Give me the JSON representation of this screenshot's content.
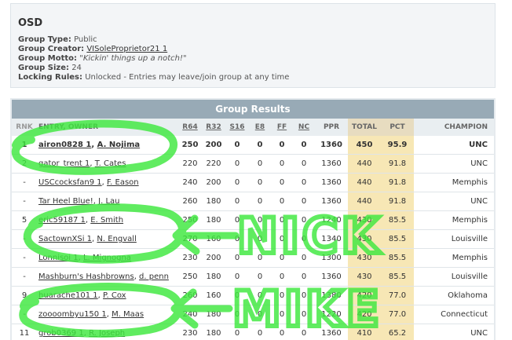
{
  "group": {
    "name": "OSD",
    "type_label": "Group Type:",
    "type_value": "Public",
    "creator_label": "Group Creator:",
    "creator_value": "VISoleProprietor21 1",
    "motto_label": "Group Motto:",
    "motto_value": "\"Kickin' things up a notch!\"",
    "size_label": "Group Size:",
    "size_value": "24",
    "locking_label": "Locking Rules:",
    "locking_value": "Unlocked - Entries may leave/join group at any time"
  },
  "results": {
    "title": "Group Results",
    "headers": {
      "rnk": "RNK",
      "entry": "ENTRY, OWNER",
      "r64": "R64",
      "r32": "R32",
      "s16": "S16",
      "e8": "E8",
      "ff": "FF",
      "nc": "NC",
      "ppr": "PPR",
      "total": "TOTAL",
      "pct": "PCT",
      "champion": "CHAMPION"
    },
    "rows": [
      {
        "rnk": "1",
        "entry": "airon0828 1",
        "owner": "A. Nojima",
        "r64": "250",
        "r32": "200",
        "s16": "0",
        "e8": "0",
        "ff": "0",
        "nc": "0",
        "ppr": "1360",
        "total": "450",
        "pct": "95.9",
        "champion": "UNC"
      },
      {
        "rnk": "2",
        "entry": "gator_trent 1",
        "owner": "T. Cates",
        "r64": "220",
        "r32": "220",
        "s16": "0",
        "e8": "0",
        "ff": "0",
        "nc": "0",
        "ppr": "1360",
        "total": "440",
        "pct": "91.8",
        "champion": "UNC"
      },
      {
        "rnk": "-",
        "entry": "USCcocksfan9 1",
        "owner": "F. Eason",
        "r64": "240",
        "r32": "200",
        "s16": "0",
        "e8": "0",
        "ff": "0",
        "nc": "0",
        "ppr": "1360",
        "total": "440",
        "pct": "91.8",
        "champion": "Memphis"
      },
      {
        "rnk": "-",
        "entry": "Tar Heel Blue!",
        "owner": "J. Lau",
        "r64": "260",
        "r32": "180",
        "s16": "0",
        "e8": "0",
        "ff": "0",
        "nc": "0",
        "ppr": "1360",
        "total": "440",
        "pct": "91.8",
        "champion": "UNC"
      },
      {
        "rnk": "5",
        "entry": "eric59187 1",
        "owner": "E. Smith",
        "r64": "250",
        "r32": "180",
        "s16": "0",
        "e8": "0",
        "ff": "0",
        "nc": "0",
        "ppr": "1240",
        "total": "430",
        "pct": "85.5",
        "champion": "Memphis"
      },
      {
        "rnk": "-",
        "entry": "SactownXSi 1",
        "owner": "N. Engvall",
        "r64": "270",
        "r32": "160",
        "s16": "0",
        "e8": "0",
        "ff": "0",
        "nc": "0",
        "ppr": "1340",
        "total": "430",
        "pct": "85.5",
        "champion": "Louisville"
      },
      {
        "rnk": "-",
        "entry": "Lonnisoi 1",
        "owner": "L. Mignogna",
        "r64": "230",
        "r32": "200",
        "s16": "0",
        "e8": "0",
        "ff": "0",
        "nc": "0",
        "ppr": "1300",
        "total": "430",
        "pct": "85.5",
        "champion": "Memphis"
      },
      {
        "rnk": "-",
        "entry": "Mashburn's Hashbrowns",
        "owner": "d. penn",
        "r64": "250",
        "r32": "180",
        "s16": "0",
        "e8": "0",
        "ff": "0",
        "nc": "0",
        "ppr": "1360",
        "total": "430",
        "pct": "85.5",
        "champion": "Louisville"
      },
      {
        "rnk": "9",
        "entry": "huarache101 1",
        "owner": "P. Cox",
        "r64": "260",
        "r32": "160",
        "s16": "0",
        "e8": "0",
        "ff": "0",
        "nc": "0",
        "ppr": "1380",
        "total": "420",
        "pct": "77.0",
        "champion": "Oklahoma"
      },
      {
        "rnk": "-",
        "entry": "zoooombyu150 1",
        "owner": "M. Maas",
        "r64": "240",
        "r32": "180",
        "s16": "0",
        "e8": "0",
        "ff": "0",
        "nc": "0",
        "ppr": "1220",
        "total": "420",
        "pct": "77.0",
        "champion": "Connecticut"
      },
      {
        "rnk": "11",
        "entry": "grob0369 1",
        "owner": "R. Joseph",
        "r64": "230",
        "r32": "180",
        "s16": "0",
        "e8": "0",
        "ff": "0",
        "nc": "0",
        "ppr": "1360",
        "total": "410",
        "pct": "65.2",
        "champion": "UNC"
      }
    ]
  },
  "annotations": {
    "color": "#3ee83e",
    "nick_label": "NICK",
    "mike_label": "MIKE"
  }
}
